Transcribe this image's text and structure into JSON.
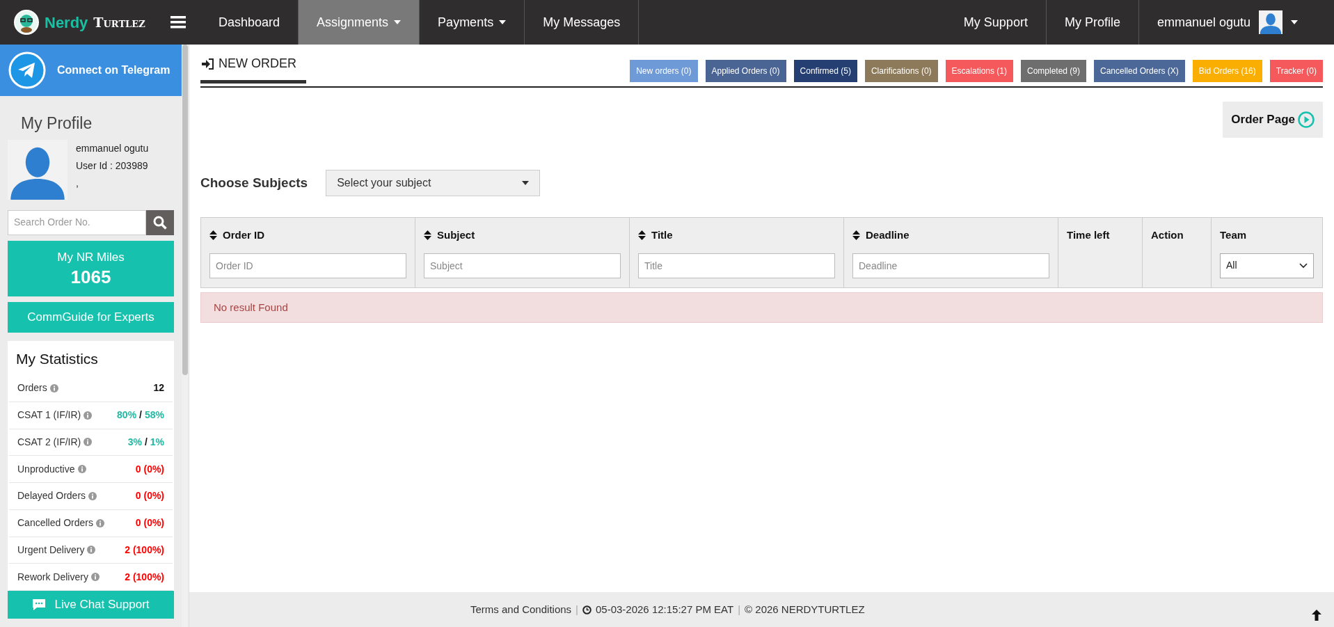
{
  "brand": {
    "first": "Nerdy",
    "second": "Turtlez"
  },
  "nav_left": [
    {
      "label": "Dashboard",
      "selected": false,
      "dropdown": false
    },
    {
      "label": "Assignments",
      "selected": true,
      "dropdown": true
    },
    {
      "label": "Payments",
      "selected": false,
      "dropdown": true
    },
    {
      "label": "My Messages",
      "selected": false,
      "dropdown": false
    }
  ],
  "nav_right": [
    {
      "label": "My Support"
    },
    {
      "label": "My Profile"
    }
  ],
  "user_menu": {
    "name": "emmanuel ogutu"
  },
  "sidebar": {
    "telegram": "Connect on Telegram",
    "profile_heading": "My Profile",
    "profile_name": "emmanuel ogutu",
    "user_id": "User Id : 203989",
    "profile_extra": ",",
    "search": {
      "placeholder": "Search Order No."
    },
    "miles": {
      "label": "My NR Miles",
      "value": "1065"
    },
    "commguide": "CommGuide for Experts",
    "stats_heading": "My Statistics",
    "stats": [
      {
        "label": "Orders",
        "parts": [
          {
            "text": "12",
            "color": "#111111"
          }
        ]
      },
      {
        "label": "CSAT 1 (IF/IR)",
        "parts": [
          {
            "text": "80%",
            "color": "#1fb9a4"
          },
          {
            "text": "/",
            "color": "#111111"
          },
          {
            "text": "58%",
            "color": "#1fb9a4"
          }
        ]
      },
      {
        "label": "CSAT 2 (IF/IR)",
        "parts": [
          {
            "text": "3%",
            "color": "#1fb9a4"
          },
          {
            "text": "/",
            "color": "#111111"
          },
          {
            "text": "1%",
            "color": "#1fb9a4"
          }
        ]
      },
      {
        "label": "Unproductive",
        "parts": [
          {
            "text": "0 (0%)",
            "color": "#ff0000"
          }
        ]
      },
      {
        "label": "Delayed Orders",
        "parts": [
          {
            "text": "0 (0%)",
            "color": "#ff0000"
          }
        ]
      },
      {
        "label": "Cancelled Orders",
        "parts": [
          {
            "text": "0 (0%)",
            "color": "#ff0000"
          }
        ]
      },
      {
        "label": "Urgent Delivery",
        "parts": [
          {
            "text": "2 (100%)",
            "color": "#ff0000"
          }
        ]
      },
      {
        "label": "Rework Delivery",
        "parts": [
          {
            "text": "2 (100%)",
            "color": "#ff0000"
          }
        ]
      }
    ],
    "live_chat": "Live Chat Support"
  },
  "page_title": "NEW ORDER",
  "status_badges": [
    {
      "label": "New orders (0)",
      "color": "#6f9ad8"
    },
    {
      "label": "Applied Orders (0)",
      "color": "#4a6493"
    },
    {
      "label": "Confirmed (5)",
      "color": "#253f73"
    },
    {
      "label": "Clarifications (0)",
      "color": "#8c7a5b"
    },
    {
      "label": "Escalations (1)",
      "color": "#f5595b"
    },
    {
      "label": "Completed (9)",
      "color": "#6e6e6e"
    },
    {
      "label": "Cancelled Orders (X)",
      "color": "#4c6898"
    },
    {
      "label": "Bid Orders (16)",
      "color": "#fbae02"
    },
    {
      "label": "Tracker (0)",
      "color": "#f5595b"
    }
  ],
  "order_page_button": "Order Page",
  "subject_chooser": {
    "label": "Choose Subjects",
    "value": "Select your subject"
  },
  "table": {
    "columns": [
      {
        "label": "Order ID",
        "kind": "sortable",
        "placeholder": "Order ID"
      },
      {
        "label": "Subject",
        "kind": "sortable",
        "placeholder": "Subject"
      },
      {
        "label": "Title",
        "kind": "sortable",
        "placeholder": "Title"
      },
      {
        "label": "Deadline",
        "kind": "sortable",
        "placeholder": "Deadline"
      },
      {
        "label": "Time left",
        "kind": "plain"
      },
      {
        "label": "Action",
        "kind": "plain"
      },
      {
        "label": "Team",
        "kind": "select",
        "value": "All"
      }
    ],
    "empty_message": "No result Found"
  },
  "footer": {
    "terms": "Terms and Conditions",
    "separator_1": "|",
    "datetime": "05-03-2026 12:15:27 PM EAT",
    "separator_2": "|",
    "copyright": "© 2026 NERDYTURTLEZ"
  }
}
